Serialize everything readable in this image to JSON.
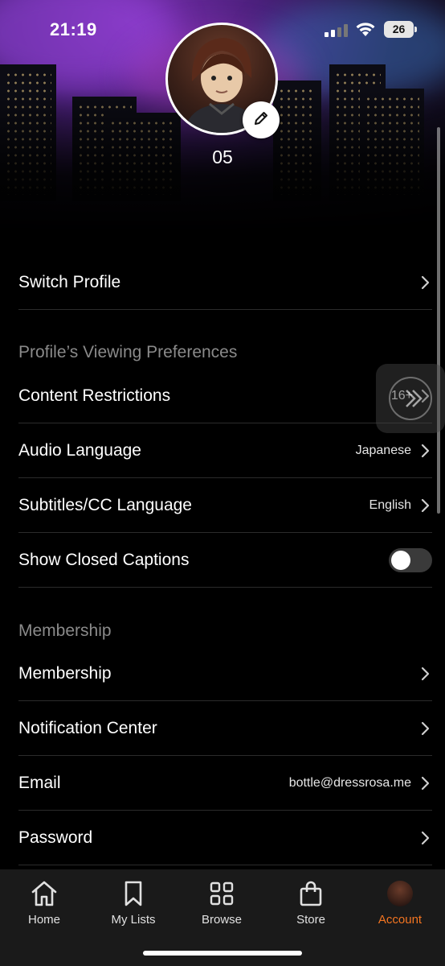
{
  "status_bar": {
    "time": "21:19",
    "battery": "26"
  },
  "profile": {
    "name": "05"
  },
  "rows": {
    "switch_profile": "Switch Profile",
    "content_restrictions": {
      "label": "Content Restrictions",
      "value": "16+"
    },
    "audio_language": {
      "label": "Audio Language",
      "value": "Japanese"
    },
    "subtitles_language": {
      "label": "Subtitles/CC Language",
      "value": "English"
    },
    "closed_captions": {
      "label": "Show Closed Captions",
      "enabled": false
    },
    "membership": "Membership",
    "notification_center": "Notification Center",
    "email": {
      "label": "Email",
      "value": "bottle@dressrosa.me"
    },
    "password": "Password"
  },
  "sections": {
    "viewing_preferences": "Profile’s Viewing Preferences",
    "membership": "Membership"
  },
  "tabs": [
    {
      "label": "Home",
      "icon": "home-icon"
    },
    {
      "label": "My Lists",
      "icon": "bookmark-icon"
    },
    {
      "label": "Browse",
      "icon": "grid-icon"
    },
    {
      "label": "Store",
      "icon": "shopping-bag-icon"
    },
    {
      "label": "Account",
      "icon": "avatar",
      "active": true
    }
  ],
  "colors": {
    "accent": "#f47521",
    "background": "#000000",
    "section_header": "#8a8a8a"
  }
}
